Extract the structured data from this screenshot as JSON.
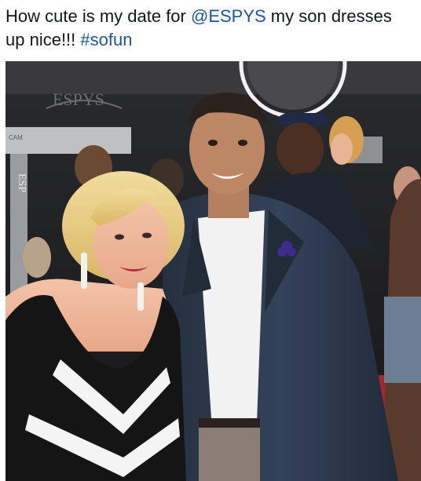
{
  "tweet": {
    "text_intro": "How cute is my date for ",
    "mention": "@ESPYS",
    "text_mid": " my son dresses up nice!!! ",
    "hashtag": "#sofun"
  },
  "photo": {
    "backdrop_letters": "ESPYS",
    "side_banner_letters": "ESP",
    "cam_label": "CAM"
  },
  "colors": {
    "link": "#1b55a0",
    "text": "#14171a",
    "carpet": "#a6272b",
    "jacket": "#2f3b4f"
  },
  "icons": {
    "lapel_pin": "flower-pin-icon"
  }
}
